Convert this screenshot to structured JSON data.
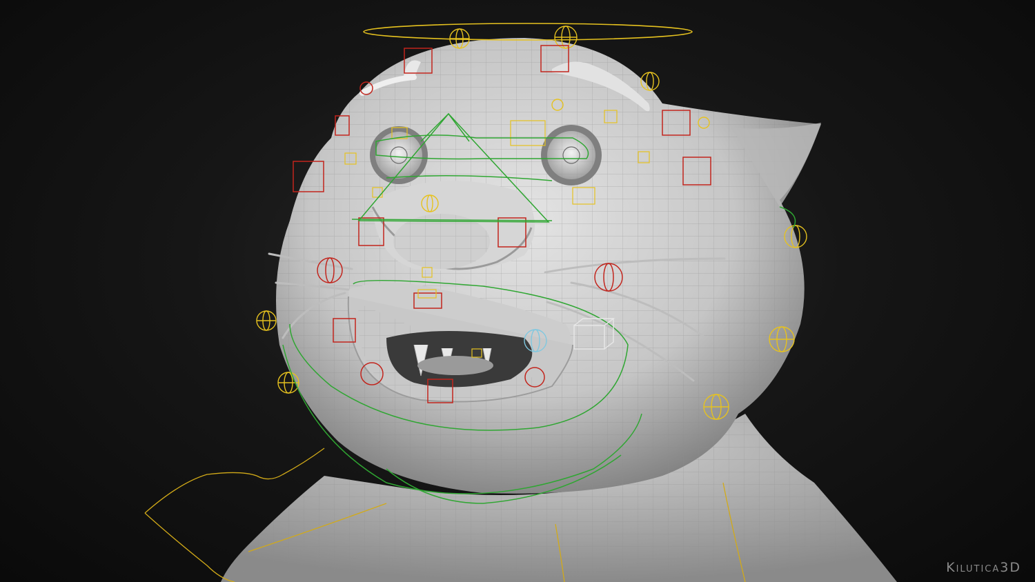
{
  "watermark": {
    "text": "Kilutica3D"
  },
  "colors": {
    "background": "#0d0d0d",
    "mesh": "#d4d4d4",
    "wireframe": "#8c8c8c",
    "control_yellow": "#e6c21f",
    "control_red": "#c2241c",
    "control_green": "#2fa632",
    "control_white": "#e8e8e8",
    "control_cyan": "#7fc8e0"
  },
  "icons": {
    "sphere_control": "sphere-control-icon",
    "box_control": "box-control-icon"
  }
}
